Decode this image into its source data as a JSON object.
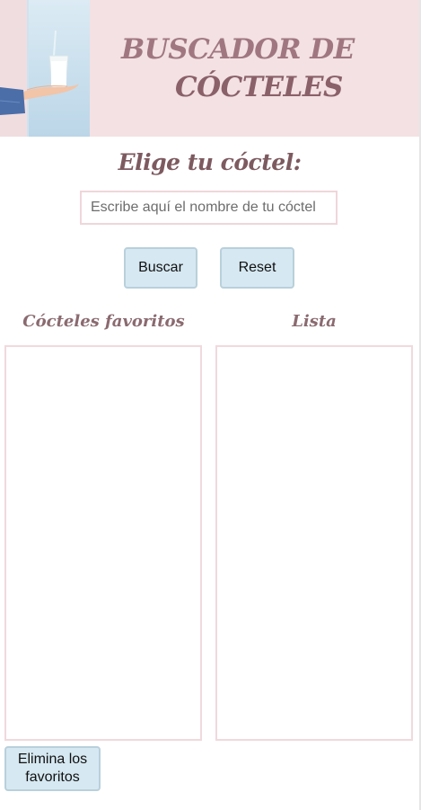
{
  "header": {
    "title_line1": "BUSCADOR DE",
    "title_line2": "CÓCTELES"
  },
  "chooser": {
    "heading": "Elige tu cóctel:",
    "search_placeholder": "Escribe aquí el nombre de tu cóctel",
    "search_button": "Buscar",
    "reset_button": "Reset"
  },
  "favorites": {
    "heading": "Cócteles favoritos",
    "items": [],
    "clear_button": "Elimina los favoritos"
  },
  "results": {
    "heading": "Lista",
    "items": []
  },
  "colors": {
    "header_bg": "#f3e1e3",
    "title": "#8a6069",
    "button_bg": "#d6e8f1",
    "box_border": "#f1d9dd"
  }
}
